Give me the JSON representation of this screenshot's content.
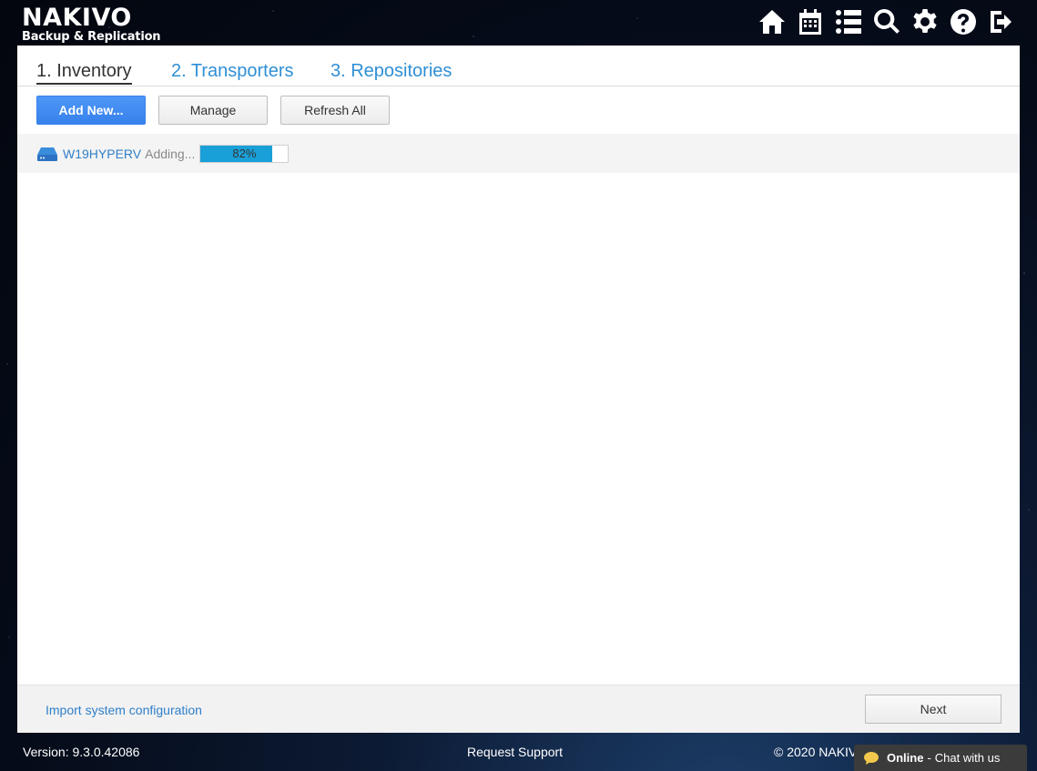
{
  "app": {
    "logo_main": "NAKIVO",
    "logo_sub": "Backup & Replication"
  },
  "topnav": {
    "icons": [
      "home-icon",
      "calendar-icon",
      "list-icon",
      "search-icon",
      "gear-icon",
      "help-icon",
      "logout-icon"
    ]
  },
  "tabs": [
    {
      "label": "1. Inventory",
      "active": true
    },
    {
      "label": "2. Transporters",
      "active": false
    },
    {
      "label": "3. Repositories",
      "active": false
    }
  ],
  "toolbar": {
    "add_label": "Add New...",
    "manage_label": "Manage",
    "refresh_label": "Refresh All"
  },
  "inventory": {
    "items": [
      {
        "name": "W19HYPERV",
        "status": "Adding...",
        "progress_pct": 82,
        "progress_label": "82%"
      }
    ]
  },
  "footer": {
    "import_label": "Import system configuration",
    "next_label": "Next"
  },
  "bottombar": {
    "version": "Version: 9.3.0.42086",
    "request_support": "Request Support",
    "copyright": "© 2020 NAKIVO"
  },
  "chat": {
    "online": "Online",
    "separator": "-",
    "text": "Chat with us"
  },
  "colors": {
    "accent_blue": "#3781ec",
    "link_blue": "#2f7fc9",
    "progress_fill": "#1aa0d8"
  }
}
